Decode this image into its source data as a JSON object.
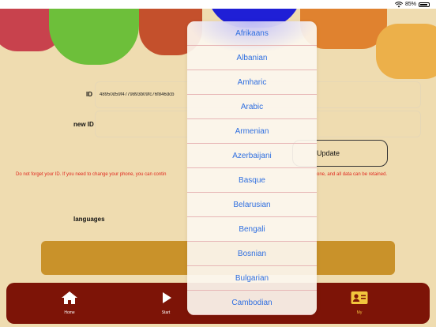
{
  "status_bar": {
    "battery": "85%",
    "battery_level": 0.85
  },
  "form": {
    "id_label": "ID",
    "id_value": "48950d59f4779893b09fc76f846dcb",
    "new_id_label": "new ID",
    "new_id_value": "",
    "update_label": "Update",
    "warning_left": "Do not forget your ID. If you need to change your phone, you can contin",
    "warning_right": "one, and all data can be retained.",
    "languages_label": "languages"
  },
  "language_picker": {
    "items": [
      "Afrikaans",
      "Albanian",
      "Amharic",
      "Arabic",
      "Armenian",
      "Azerbaijani",
      "Basque",
      "Belarusian",
      "Bengali",
      "Bosnian",
      "Bulgarian",
      "Cambodian"
    ]
  },
  "tab_bar": {
    "tabs": [
      {
        "label": "Home",
        "icon": "home-icon"
      },
      {
        "label": "Start",
        "icon": "play-icon"
      },
      {
        "label": "My",
        "icon": "contact-card-icon",
        "active": true
      }
    ],
    "active_color": "#f2c53d"
  },
  "colors": {
    "background": "#efdcb0",
    "tab_bar": "#7d1407",
    "picker_text": "#2f6fe0",
    "warning": "#e0291f",
    "language_select": "#c9922a"
  }
}
